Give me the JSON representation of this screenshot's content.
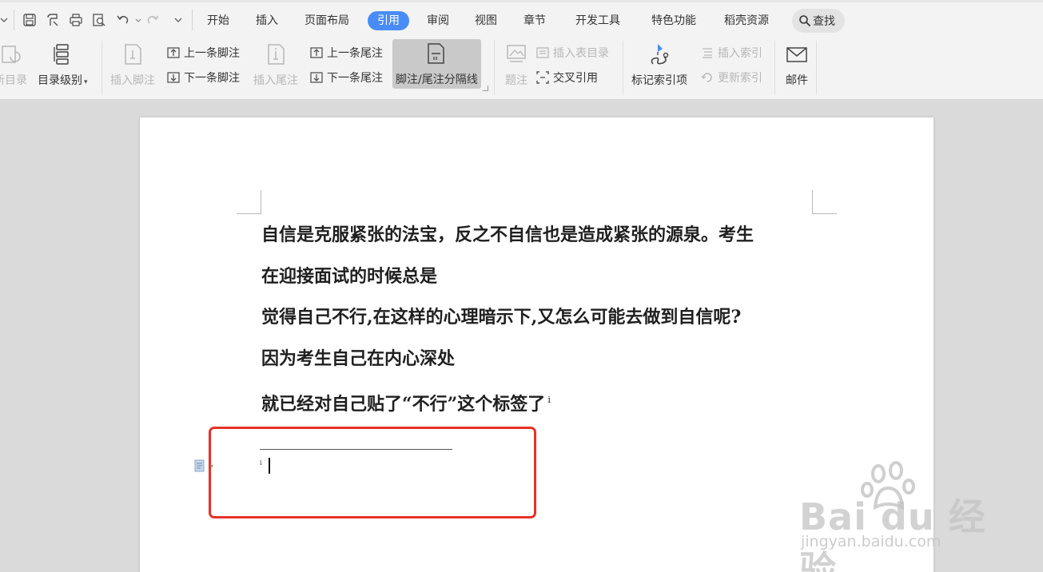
{
  "menubar": {
    "tabs": [
      "开始",
      "插入",
      "页面布局",
      "引用",
      "审阅",
      "视图",
      "章节",
      "开发工具",
      "特色功能",
      "稻壳资源"
    ],
    "active_tab": "引用",
    "search_label": "查找"
  },
  "ribbon": {
    "update_toc": "新目录",
    "toc_level": "目录级别",
    "insert_footnote": "插入脚注",
    "prev_footnote": "上一条脚注",
    "next_footnote": "下一条脚注",
    "insert_endnote": "插入尾注",
    "prev_endnote": "上一条尾注",
    "next_endnote": "下一条尾注",
    "separator_line": "脚注/尾注分隔线",
    "caption": "题注",
    "insert_table_of_figures": "插入表目录",
    "cross_reference": "交叉引用",
    "mark_index_entry": "标记索引项",
    "insert_index": "插入索引",
    "update_index": "更新索引",
    "mail": "邮件"
  },
  "document": {
    "paragraphs": [
      "自信是克服紧张的法宝，反之不自信也是造成紧张的源泉。考生",
      "在迎接面试的时候总是",
      "觉得自己不行,在这样的心理暗示下,又怎么可能去做到自信呢?",
      "因为考生自己在内心深处",
      "就已经对自己贴了“不行”这个标签了"
    ],
    "footnote_ref": "i",
    "footnote_mark": "i"
  },
  "colors": {
    "accent": "#4a8cf7",
    "highlight_box": "#e53226"
  },
  "watermark": {
    "logo": "Bai du 经验",
    "url": "jingyan.baidu.com"
  }
}
